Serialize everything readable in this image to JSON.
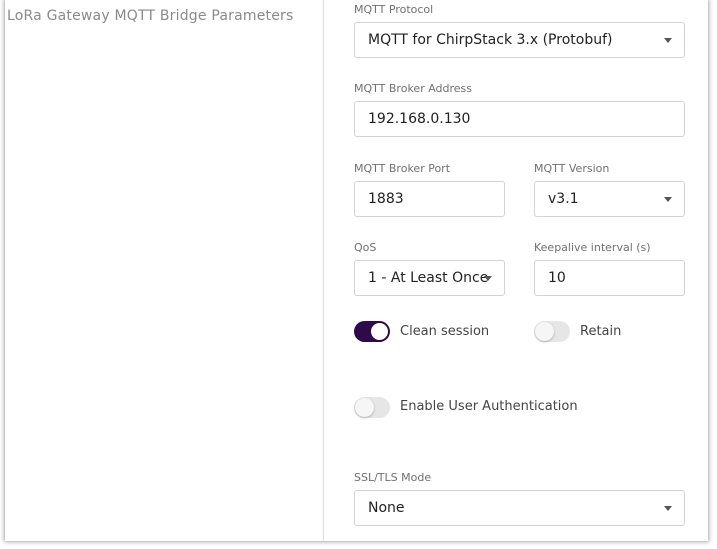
{
  "section": {
    "title": "LoRa Gateway MQTT Bridge Parameters"
  },
  "fields": {
    "mqtt_protocol": {
      "label": "MQTT Protocol",
      "value": "MQTT for ChirpStack 3.x (Protobuf)"
    },
    "broker_address": {
      "label": "MQTT Broker Address",
      "value": "192.168.0.130"
    },
    "broker_port": {
      "label": "MQTT Broker Port",
      "value": "1883"
    },
    "mqtt_version": {
      "label": "MQTT Version",
      "value": "v3.1"
    },
    "qos": {
      "label": "QoS",
      "value": "1 - At Least Once"
    },
    "keepalive": {
      "label": "Keepalive interval (s)",
      "value": "10"
    },
    "ssl_tls_mode": {
      "label": "SSL/TLS Mode",
      "value": "None"
    }
  },
  "toggles": {
    "clean_session": {
      "label": "Clean session",
      "checked": true
    },
    "retain": {
      "label": "Retain",
      "checked": false
    },
    "user_auth": {
      "label": "Enable User Authentication",
      "checked": false
    }
  },
  "colors": {
    "toggle_on": "#2e0a4b",
    "toggle_off": "#e6e6e6",
    "border": "#d3d3d3",
    "label": "#707070"
  },
  "icons": {
    "select_caret": "chevron-down-icon"
  }
}
